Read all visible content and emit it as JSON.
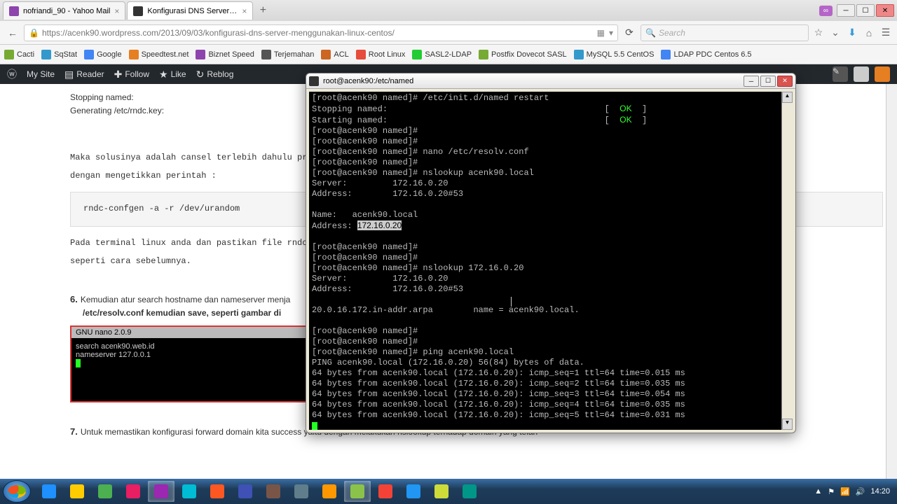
{
  "browser": {
    "tabs": [
      {
        "label": "nofriandi_90 - Yahoo Mail"
      },
      {
        "label": "Konfigurasi DNS Server Pa..."
      }
    ],
    "url": "https://acenk90.wordpress.com/2013/09/03/konfigurasi-dns-server-menggunakan-linux-centos/",
    "search_placeholder": "Search",
    "toolbar_icons": [
      "star",
      "pocket",
      "download",
      "home",
      "menu"
    ]
  },
  "bookmarks": [
    "Cacti",
    "SqStat",
    "Google",
    "Speedtest.net",
    "Biznet Speed",
    "Terjemahan",
    "ACL",
    "Root Linux",
    "SASL2-LDAP",
    "Postfix Dovecot SASL",
    "MySQL 5.5 CentOS",
    "LDAP PDC Centos 6.5"
  ],
  "wpbar": {
    "items": [
      "My Site",
      "Reader",
      "Follow",
      "Like",
      "Reblog"
    ]
  },
  "article": {
    "code1_l1": "Stopping named:",
    "code1_l2": "Generating /etc/rndc.key:",
    "para1": "Maka solusinya adalah cansel terlebih dahulu prose",
    "para2": "dengan mengetikkan perintah :",
    "code2": "rndc-confgen -a -r /dev/urandom",
    "para3": "Pada terminal linux anda dan pastikan file rndc.ke",
    "para4": "seperti cara sebelumnya.",
    "step6_num": "6.",
    "step6_a": "Kemudian atur search hostname dan nameserver menja",
    "step6_b": "/etc/resolv.conf kemudian save, seperti gambar di",
    "nano_title": "GNU nano 2.0.9",
    "nano_l1": "search acenk90.web.id",
    "nano_l2": "nameserver 127.0.0.1",
    "step7_num": "7.",
    "step7": "Untuk memastikan konfigurasi forward domain kita success yaitu dengan melakukan nslookup terhadap domain yang telah"
  },
  "putty": {
    "title": "root@acenk90:/etc/named",
    "lines": [
      {
        "t": "[root@acenk90 named]# /etc/init.d/named restart"
      },
      {
        "t": "Stopping named:                                           [  ",
        "ok": "OK",
        "t2": "  ]"
      },
      {
        "t": "Starting named:                                           [  ",
        "ok": "OK",
        "t2": "  ]"
      },
      {
        "t": "[root@acenk90 named]#"
      },
      {
        "t": "[root@acenk90 named]#"
      },
      {
        "t": "[root@acenk90 named]# nano /etc/resolv.conf"
      },
      {
        "t": "[root@acenk90 named]#"
      },
      {
        "t": "[root@acenk90 named]# nslookup acenk90.local"
      },
      {
        "t": "Server:         172.16.0.20"
      },
      {
        "t": "Address:        172.16.0.20#53"
      },
      {
        "t": ""
      },
      {
        "t": "Name:   acenk90.local"
      },
      {
        "t": "Address: ",
        "hl": "172.16.0.20"
      },
      {
        "t": ""
      },
      {
        "t": "[root@acenk90 named]#"
      },
      {
        "t": "[root@acenk90 named]#"
      },
      {
        "t": "[root@acenk90 named]# nslookup 172.16.0.20"
      },
      {
        "t": "Server:         172.16.0.20"
      },
      {
        "t": "Address:        172.16.0.20#53"
      },
      {
        "t": ""
      },
      {
        "t": "20.0.16.172.in-addr.arpa        name = acenk90.local."
      },
      {
        "t": ""
      },
      {
        "t": "[root@acenk90 named]#"
      },
      {
        "t": "[root@acenk90 named]#"
      },
      {
        "t": "[root@acenk90 named]# ping acenk90.local"
      },
      {
        "t": "PING acenk90.local (172.16.0.20) 56(84) bytes of data."
      },
      {
        "t": "64 bytes from acenk90.local (172.16.0.20): icmp_seq=1 ttl=64 time=0.015 ms"
      },
      {
        "t": "64 bytes from acenk90.local (172.16.0.20): icmp_seq=2 ttl=64 time=0.035 ms"
      },
      {
        "t": "64 bytes from acenk90.local (172.16.0.20): icmp_seq=3 ttl=64 time=0.054 ms"
      },
      {
        "t": "64 bytes from acenk90.local (172.16.0.20): icmp_seq=4 ttl=64 time=0.035 ms"
      },
      {
        "t": "64 bytes from acenk90.local (172.16.0.20): icmp_seq=5 ttl=64 time=0.031 ms"
      }
    ]
  },
  "taskbar": {
    "apps": [
      "#1e90ff",
      "#ffcc00",
      "#4caf50",
      "#e91e63",
      "#9c27b0",
      "#00bcd4",
      "#ff5722",
      "#3f51b5",
      "#795548",
      "#607d8b",
      "#ff9800",
      "#8bc34a",
      "#f44336",
      "#2196f3",
      "#cddc39",
      "#009688"
    ],
    "time": "14:20"
  }
}
